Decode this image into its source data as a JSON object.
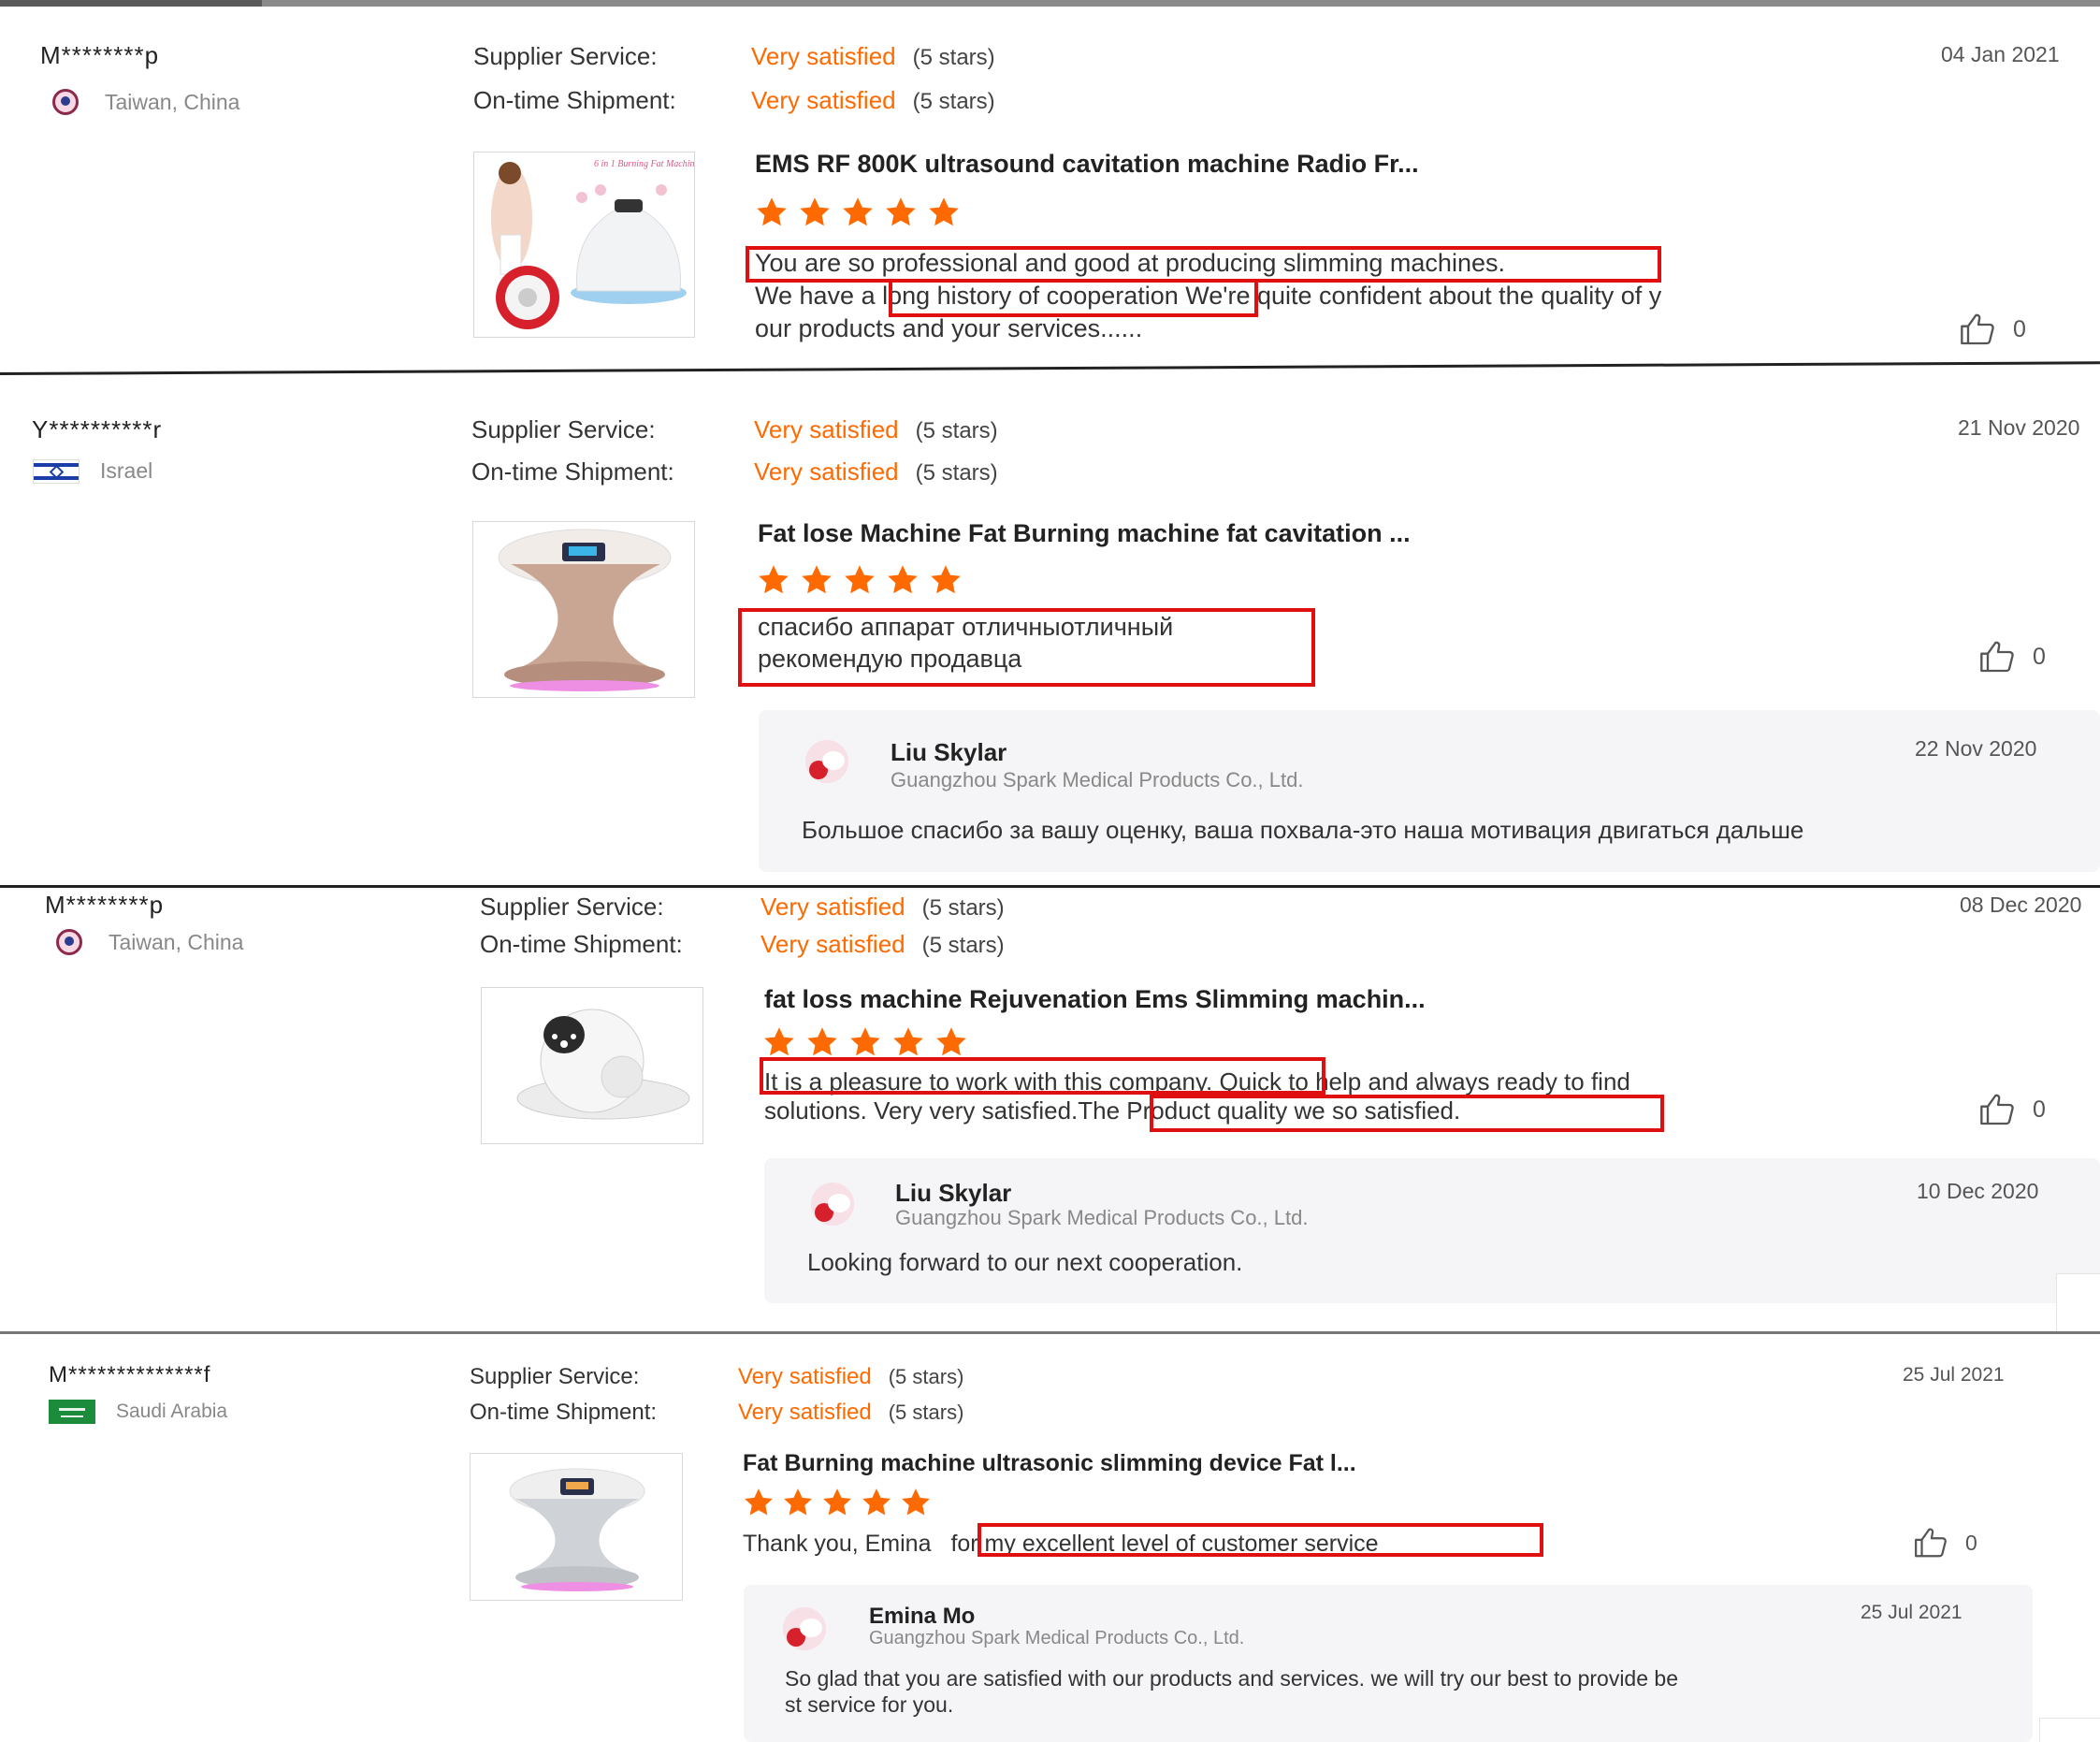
{
  "labels": {
    "supplier_service": "Supplier Service:",
    "ontime_shipment": "On-time Shipment:",
    "very_satisfied": "Very satisfied",
    "five_stars": "(5 stars)"
  },
  "colors": {
    "accent": "#ff6a00",
    "highlight": "#e01010",
    "reply_bg": "#f5f5f7"
  },
  "reviews": [
    {
      "buyer": "M********p",
      "location": "Taiwan, China",
      "flag_icon": "taiwan-flag-icon",
      "date": "04 Jan 2021",
      "product_title": "EMS RF 800K ultrasound cavitation machine Radio Fr...",
      "thumb_caption": "6 in 1 Burning Fat Machine",
      "rating": 5,
      "comment": {
        "hl1": "You are so professional and good at producing slimming machines.",
        "pre2": "We have a ",
        "hl2": "long history of cooperation",
        "post2": " We're quite confident about the quality of y",
        "line3": "our products and your services......"
      },
      "likes": "0"
    },
    {
      "buyer": "Y**********r",
      "location": "Israel",
      "flag_icon": "israel-flag-icon",
      "date": "21 Nov 2020",
      "product_title": "Fat lose Machine Fat Burning machine fat cavitation ...",
      "rating": 5,
      "comment": {
        "line1": "спасибо  аппарат отличныотличный",
        "line2": "рекомендую продавца"
      },
      "likes": "0",
      "reply": {
        "name": "Liu Skylar",
        "company": "Guangzhou Spark Medical Products Co., Ltd.",
        "date": "22 Nov 2020",
        "text": "Большое спасибо за вашу оценку, ваша похвала-это наша мотивация двигаться дальше"
      }
    },
    {
      "buyer": "M********p",
      "location": "Taiwan, China",
      "flag_icon": "taiwan-flag-icon",
      "date": "08 Dec 2020",
      "product_title": "fat loss machine Rejuvenation Ems Slimming machin...",
      "rating": 5,
      "comment": {
        "hl1": "It is a pleasure to work with this company.",
        "post1": " Quick to help and always ready to find",
        "pre2": "solutions. Very very satisfied.",
        "hl2": "The Product quality we so satisfied."
      },
      "likes": "0",
      "reply": {
        "name": "Liu Skylar",
        "company": "Guangzhou Spark Medical Products Co., Ltd.",
        "date": "10 Dec 2020",
        "text": "Looking forward to our next cooperation."
      }
    },
    {
      "buyer": "M**************f",
      "location": "Saudi Arabia",
      "flag_icon": "saudi-arabia-flag-icon",
      "date": "25 Jul 2021",
      "product_title": "Fat Burning machine ultrasonic slimming device Fat l...",
      "rating": 5,
      "comment": {
        "pre1": "Thank you, Emina ",
        "hl1": "for my excellent level of customer service"
      },
      "likes": "0",
      "reply": {
        "name": "Emina Mo",
        "company": "Guangzhou Spark Medical Products Co., Ltd.",
        "date": "25 Jul 2021",
        "text1": "So glad that you are satisfied with our products and services. we will try our best to provide be",
        "text2": "st service for you."
      }
    }
  ]
}
